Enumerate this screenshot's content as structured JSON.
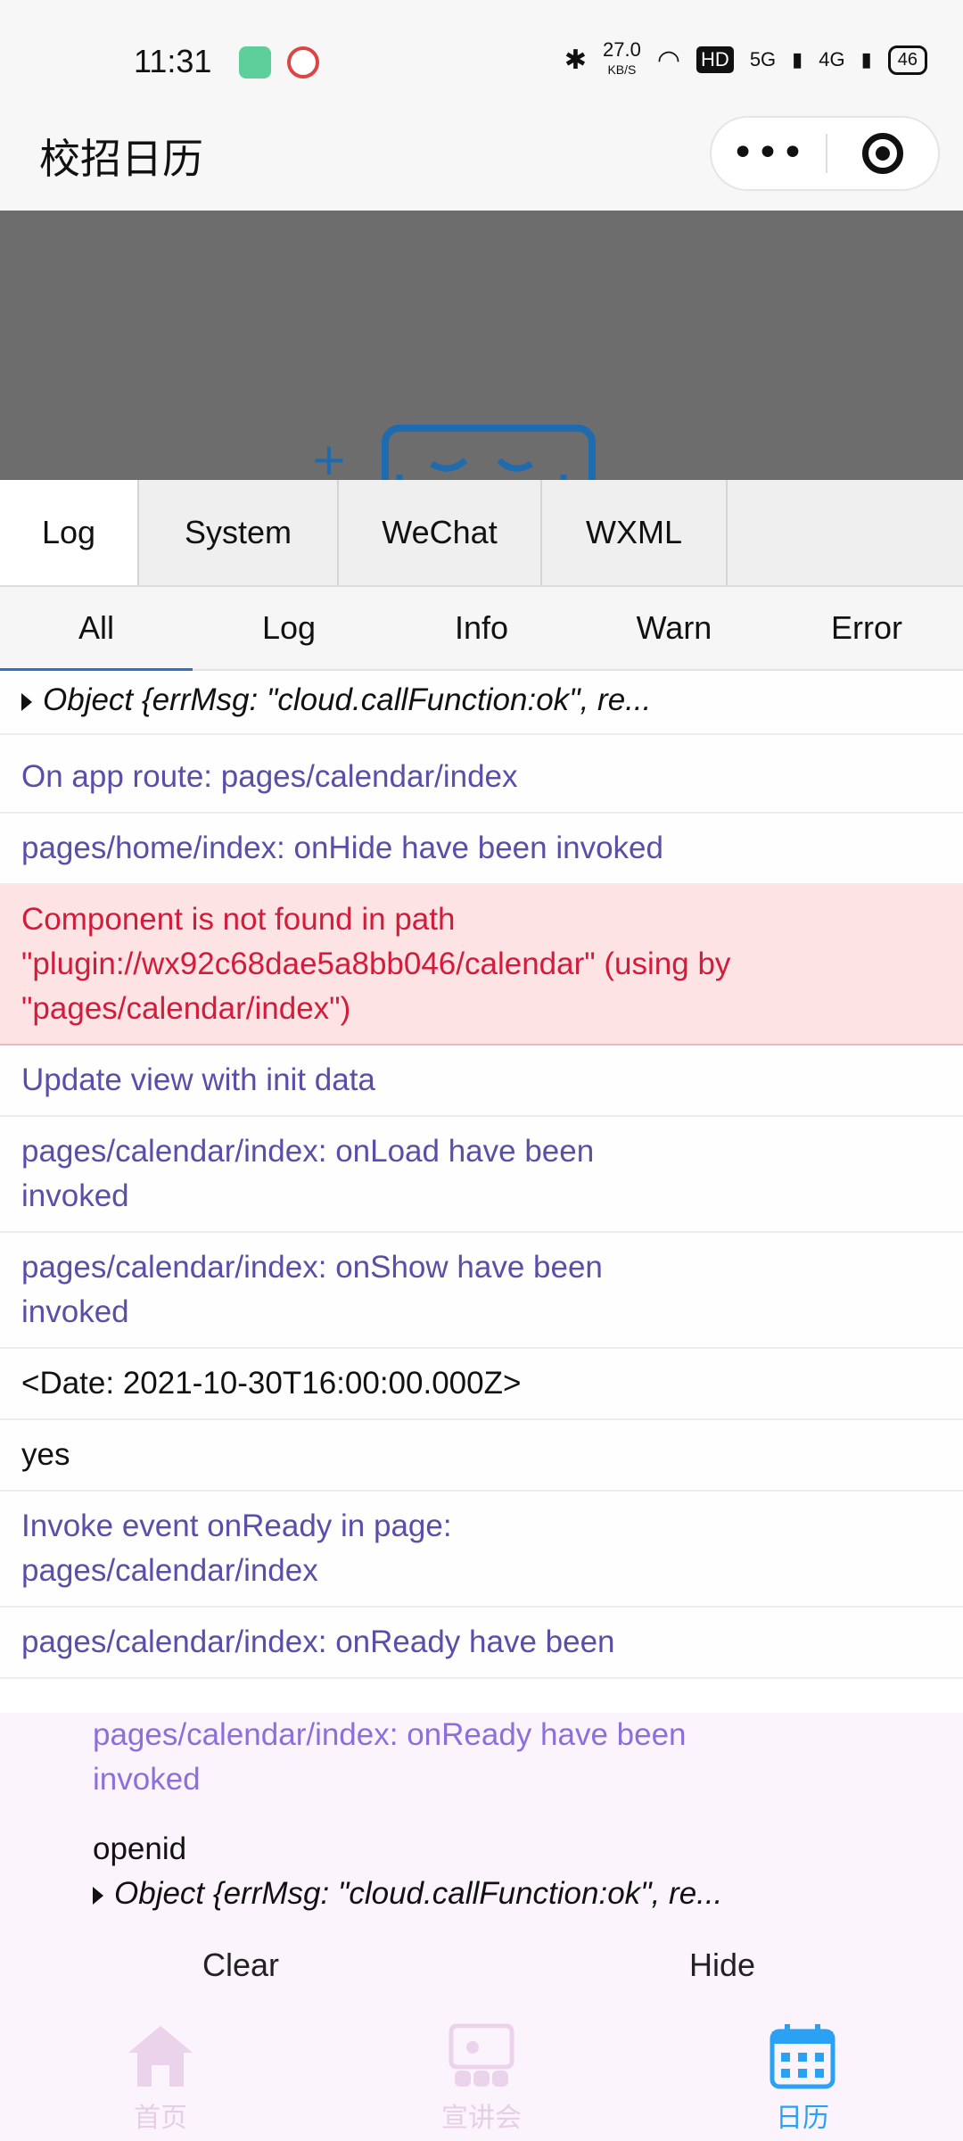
{
  "status_bar": {
    "time": "11:31",
    "speed": "27.0",
    "speed_unit": "KB/S",
    "hd": "HD",
    "net1": "5G",
    "net2": "4G",
    "battery": "46"
  },
  "nav": {
    "title": "校招日历",
    "more_icon": "more-dots-icon",
    "target_icon": "record-target-icon"
  },
  "console": {
    "tabs": [
      "Log",
      "System",
      "WeChat",
      "WXML"
    ],
    "active_tab": "Log",
    "filters": [
      "All",
      "Log",
      "Info",
      "Warn",
      "Error"
    ],
    "active_filter": "All",
    "entries": [
      {
        "type": "obj",
        "text": "Object {errMsg: \"cloud.callFunction:ok\", re..."
      },
      {
        "type": "info",
        "text": "On app route: pages/calendar/index"
      },
      {
        "type": "info",
        "text": "pages/home/index: onHide have been invoked"
      },
      {
        "type": "err",
        "text": "Component is not found in path \"plugin://wx92c68dae5a8bb046/calendar\" (using by \"pages/calendar/index\")"
      },
      {
        "type": "info",
        "text": "Update view with init data"
      },
      {
        "type": "info",
        "text": "pages/calendar/index: onLoad have been invoked"
      },
      {
        "type": "info",
        "text": "pages/calendar/index: onShow have been invoked"
      },
      {
        "type": "plain",
        "text": "<Date: 2021-10-30T16:00:00.000Z>"
      },
      {
        "type": "plain",
        "text": "yes"
      },
      {
        "type": "info",
        "text": "Invoke event onReady in page: pages/calendar/index"
      },
      {
        "type": "plain",
        "text": "pages/calendar/index: onReady have been"
      }
    ]
  },
  "panel": {
    "info_line": "pages/calendar/index: onReady have been invoked",
    "plain_line": "openid",
    "obj_line": "Object {errMsg: \"cloud.callFunction:ok\", re...",
    "clear_label": "Clear",
    "hide_label": "Hide"
  },
  "tabbar": {
    "items": [
      {
        "label": "首页",
        "icon": "home-icon"
      },
      {
        "label": "宣讲会",
        "icon": "presentation-icon"
      },
      {
        "label": "日历",
        "icon": "calendar-icon"
      }
    ],
    "active": "日历"
  },
  "colors": {
    "info": "#5a4fa8",
    "error": "#d21c3c",
    "error_bg": "#fde3e3",
    "tab_active": "#2ba1f3"
  }
}
